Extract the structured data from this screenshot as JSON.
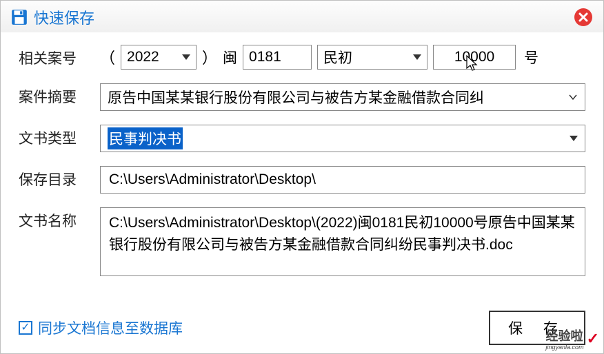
{
  "titlebar": {
    "title": "快速保存"
  },
  "form": {
    "caseNumber": {
      "label": "相关案号",
      "lparen": "（",
      "year": "2022",
      "rparen": "）",
      "region": "闽",
      "code": "0181",
      "caseType": "民初",
      "sequence": "10000",
      "suffix": "号"
    },
    "summary": {
      "label": "案件摘要",
      "value": "原告中国某某银行股份有限公司与被告方某金融借款合同纠"
    },
    "docType": {
      "label": "文书类型",
      "value": "民事判决书"
    },
    "saveDir": {
      "label": "保存目录",
      "value": "C:\\Users\\Administrator\\Desktop\\"
    },
    "docName": {
      "label": "文书名称",
      "value": "C:\\Users\\Administrator\\Desktop\\(2022)闽0181民初10000号原告中国某某银行股份有限公司与被告方某金融借款合同纠纷民事判决书.doc"
    }
  },
  "footer": {
    "syncLabel": "同步文档信息至数据库",
    "syncChecked": true,
    "saveButton": "保 存"
  },
  "watermark": {
    "main": "经验啦",
    "sub": "jingyanla.com"
  }
}
